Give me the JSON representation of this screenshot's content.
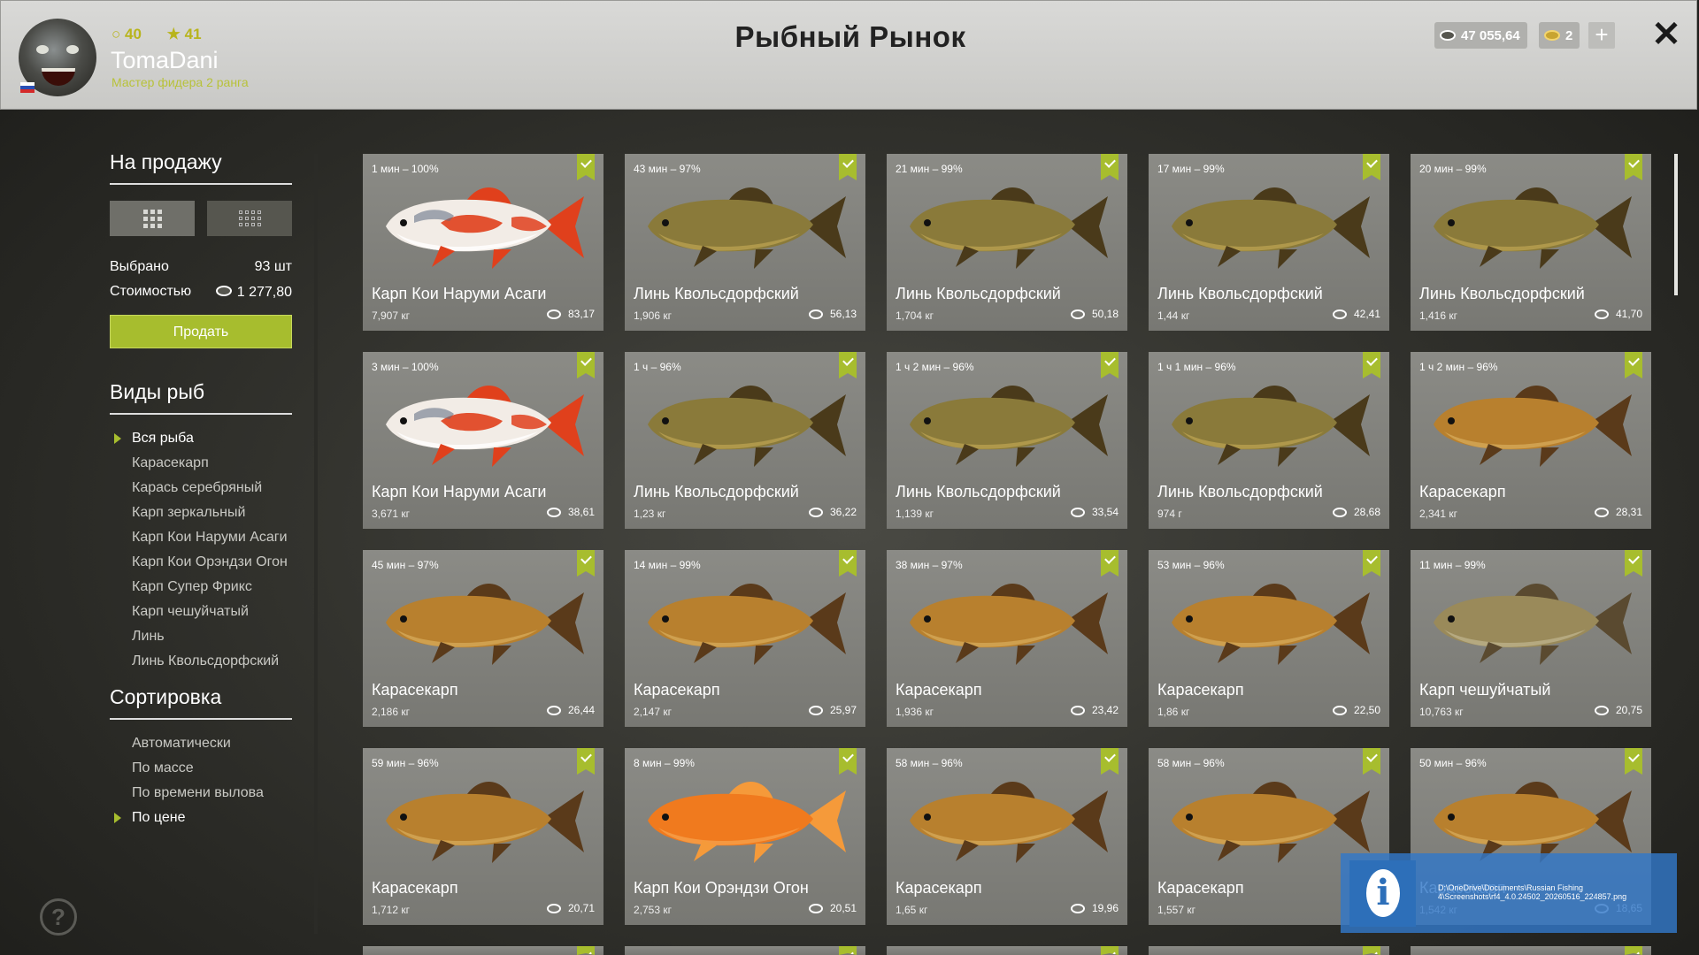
{
  "header": {
    "title": "Рыбный Рынок",
    "player": {
      "name": "TomaDani",
      "rank": "Мастер фидера 2 ранга",
      "level": "40",
      "stars": "41"
    },
    "silver": "47 055,64",
    "gold": "2",
    "plus_label": "+",
    "close_label": "✕"
  },
  "sidebar": {
    "for_sale_title": "На продажу",
    "selected_label": "Выбрано",
    "selected_value": "93 шт",
    "cost_label": "Стоимостью",
    "cost_value": "1 277,80",
    "sell_button": "Продать",
    "species_title": "Виды рыб",
    "species": [
      "Вся рыба",
      "Карасекарп",
      "Карась серебряный",
      "Карп зеркальный",
      "Карп Кои Наруми Асаги",
      "Карп Кои Орэндзи Огон",
      "Карп Супер Фрикс",
      "Карп чешуйчатый",
      "Линь",
      "Линь Квольсдорфский"
    ],
    "sort_title": "Сортировка",
    "sort_options": [
      "Автоматически",
      "По массе",
      "По времени вылова",
      "По цене"
    ],
    "help_label": "?"
  },
  "fish": [
    {
      "time": "1 мин – 100%",
      "name": "Карп Кои Наруми Асаги",
      "weight": "7,907 кг",
      "price": "83,17",
      "kind": "koi"
    },
    {
      "time": "43 мин – 97%",
      "name": "Линь Квольсдорфский",
      "weight": "1,906 кг",
      "price": "56,13",
      "kind": "tench"
    },
    {
      "time": "21 мин – 99%",
      "name": "Линь Квольсдорфский",
      "weight": "1,704 кг",
      "price": "50,18",
      "kind": "tench"
    },
    {
      "time": "17 мин – 99%",
      "name": "Линь Квольсдорфский",
      "weight": "1,44 кг",
      "price": "42,41",
      "kind": "tench"
    },
    {
      "time": "20 мин – 99%",
      "name": "Линь Квольсдорфский",
      "weight": "1,416 кг",
      "price": "41,70",
      "kind": "tench"
    },
    {
      "time": "3 мин – 100%",
      "name": "Карп Кои Наруми Асаги",
      "weight": "3,671 кг",
      "price": "38,61",
      "kind": "koi"
    },
    {
      "time": "1 ч – 96%",
      "name": "Линь Квольсдорфский",
      "weight": "1,23 кг",
      "price": "36,22",
      "kind": "tench"
    },
    {
      "time": "1 ч 2 мин – 96%",
      "name": "Линь Квольсдорфский",
      "weight": "1,139 кг",
      "price": "33,54",
      "kind": "tench"
    },
    {
      "time": "1 ч 1 мин – 96%",
      "name": "Линь Квольсдорфский",
      "weight": "974 г",
      "price": "28,68",
      "kind": "tench"
    },
    {
      "time": "1 ч 2 мин – 96%",
      "name": "Карасекарп",
      "weight": "2,341 кг",
      "price": "28,31",
      "kind": "hybrid"
    },
    {
      "time": "45 мин – 97%",
      "name": "Карасекарп",
      "weight": "2,186 кг",
      "price": "26,44",
      "kind": "hybrid"
    },
    {
      "time": "14 мин – 99%",
      "name": "Карасекарп",
      "weight": "2,147 кг",
      "price": "25,97",
      "kind": "hybrid"
    },
    {
      "time": "38 мин – 97%",
      "name": "Карасекарп",
      "weight": "1,936 кг",
      "price": "23,42",
      "kind": "hybrid"
    },
    {
      "time": "53 мин – 96%",
      "name": "Карасекарп",
      "weight": "1,86 кг",
      "price": "22,50",
      "kind": "hybrid"
    },
    {
      "time": "11 мин – 99%",
      "name": "Карп чешуйчатый",
      "weight": "10,763 кг",
      "price": "20,75",
      "kind": "carp"
    },
    {
      "time": "59 мин – 96%",
      "name": "Карасекарп",
      "weight": "1,712 кг",
      "price": "20,71",
      "kind": "hybrid"
    },
    {
      "time": "8 мин – 99%",
      "name": "Карп Кои Орэндзи Огон",
      "weight": "2,753 кг",
      "price": "20,51",
      "kind": "ogon"
    },
    {
      "time": "58 мин – 96%",
      "name": "Карасекарп",
      "weight": "1,65 кг",
      "price": "19,96",
      "kind": "hybrid"
    },
    {
      "time": "58 мин – 96%",
      "name": "Карасекарп",
      "weight": "1,557 кг",
      "price": "",
      "kind": "hybrid"
    },
    {
      "time": "50 мин – 96%",
      "name": "Карасекарп",
      "weight": "1,542 кг",
      "price": "18,65",
      "kind": "hybrid"
    }
  ],
  "notification": {
    "text": "D:\\OneDrive\\Documents\\Russian Fishing 4\\Screenshots\\rf4_4.0.24502_20260516_224857.png"
  },
  "colors": {
    "accent": "#a7bd2e",
    "koi_red": "#e0401c",
    "tench": "#8a7a3a",
    "hybrid": "#b8802e",
    "ogon": "#f07a1e",
    "carp": "#9a8a5a"
  }
}
